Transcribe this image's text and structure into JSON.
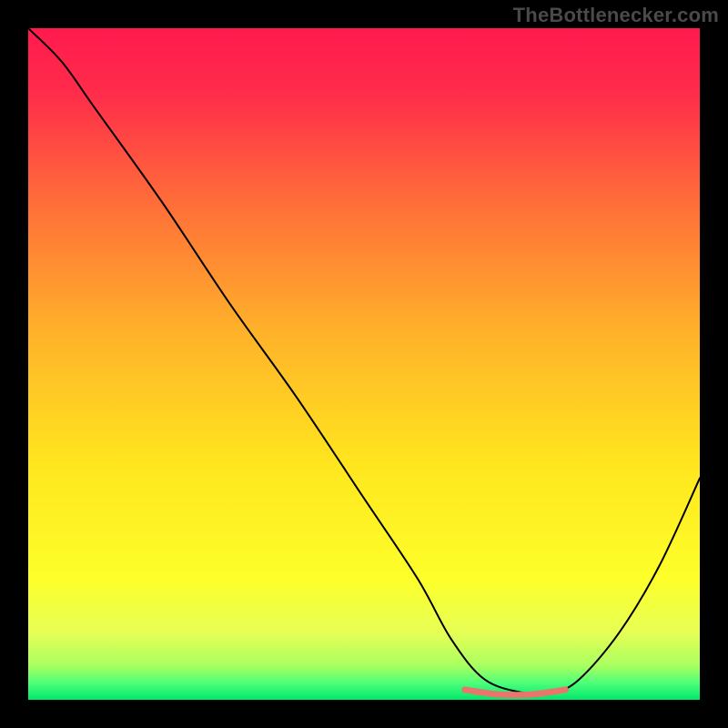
{
  "watermark": "TheBottlenecker.com",
  "chart_data": {
    "type": "line",
    "title": "",
    "xlabel": "",
    "ylabel": "",
    "xlim": [
      0,
      100
    ],
    "ylim": [
      0,
      100
    ],
    "grid": false,
    "legend": false,
    "gradient_stops": [
      {
        "pos": 0.0,
        "color": "#ff1a4e"
      },
      {
        "pos": 0.1,
        "color": "#ff2d4a"
      },
      {
        "pos": 0.25,
        "color": "#ff6a3a"
      },
      {
        "pos": 0.45,
        "color": "#ffb12a"
      },
      {
        "pos": 0.65,
        "color": "#ffe61e"
      },
      {
        "pos": 0.82,
        "color": "#fdff2a"
      },
      {
        "pos": 0.9,
        "color": "#e6ff55"
      },
      {
        "pos": 0.95,
        "color": "#a8ff60"
      },
      {
        "pos": 0.975,
        "color": "#4dff7a"
      },
      {
        "pos": 1.0,
        "color": "#00e86b"
      }
    ],
    "series": [
      {
        "name": "bottleneck-curve",
        "color": "#000000",
        "x": [
          0,
          5,
          10,
          20,
          30,
          40,
          50,
          58,
          63,
          68,
          74,
          78,
          82,
          88,
          94,
          100
        ],
        "y": [
          100,
          95,
          88,
          74,
          59,
          45,
          30,
          18,
          9,
          3,
          1,
          1,
          3,
          10,
          20,
          33
        ]
      },
      {
        "name": "optimal-band",
        "color": "#e9766d",
        "x": [
          65,
          70,
          75,
          80
        ],
        "y": [
          1.5,
          0.8,
          0.8,
          1.5
        ]
      }
    ],
    "optimal_range_x": [
      65,
      80
    ]
  }
}
